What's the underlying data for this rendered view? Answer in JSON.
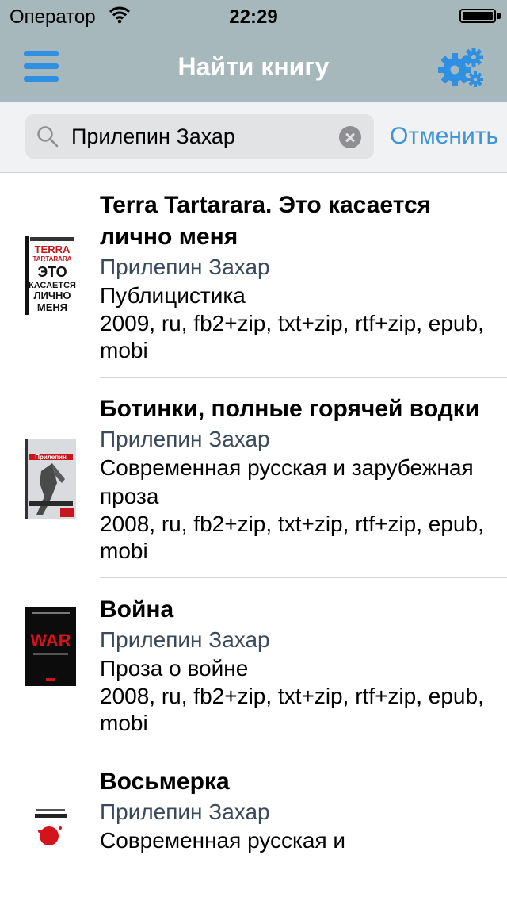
{
  "status_bar": {
    "carrier": "Оператор",
    "time": "22:29",
    "icons": [
      "wifi-icon",
      "battery-icon"
    ]
  },
  "nav_bar": {
    "title": "Найти книгу",
    "left_icon": "menu-icon",
    "right_icon": "gear-icon",
    "accent_color": "#2f8fe0"
  },
  "search": {
    "value": "Прилепин Захар",
    "cancel_label": "Отменить",
    "icons": [
      "search-icon",
      "clear-icon"
    ]
  },
  "books": [
    {
      "title": "Terra Tartarara. Это касается лично меня",
      "author": "Прилепин Захар",
      "genre": "Публицистика",
      "meta": "2009, ru, fb2+zip, txt+zip, rtf+zip, epub, mobi",
      "cover_text": "TERRA TARTARARA ЭТО КАСАЕТСЯ ЛИЧНО МЕНЯ"
    },
    {
      "title": "Ботинки, полные горячей водки",
      "author": "Прилепин Захар",
      "genre": "Современная русская и зарубежная проза",
      "meta": "2008, ru, fb2+zip, txt+zip, rtf+zip, epub, mobi",
      "cover_text": "Прилепин"
    },
    {
      "title": "Война",
      "author": "Прилепин Захар",
      "genre": "Проза о войне",
      "meta": "2008, ru, fb2+zip, txt+zip, rtf+zip, epub, mobi",
      "cover_text": "WAR"
    },
    {
      "title": "Восьмерка",
      "author": "Прилепин Захар",
      "genre": "Современная русская и",
      "meta": "",
      "cover_text": "Восьмерка"
    }
  ],
  "colors": {
    "nav_background": "#a6b8bc",
    "link": "#3d94d8",
    "author_text": "#3a4a5c"
  }
}
